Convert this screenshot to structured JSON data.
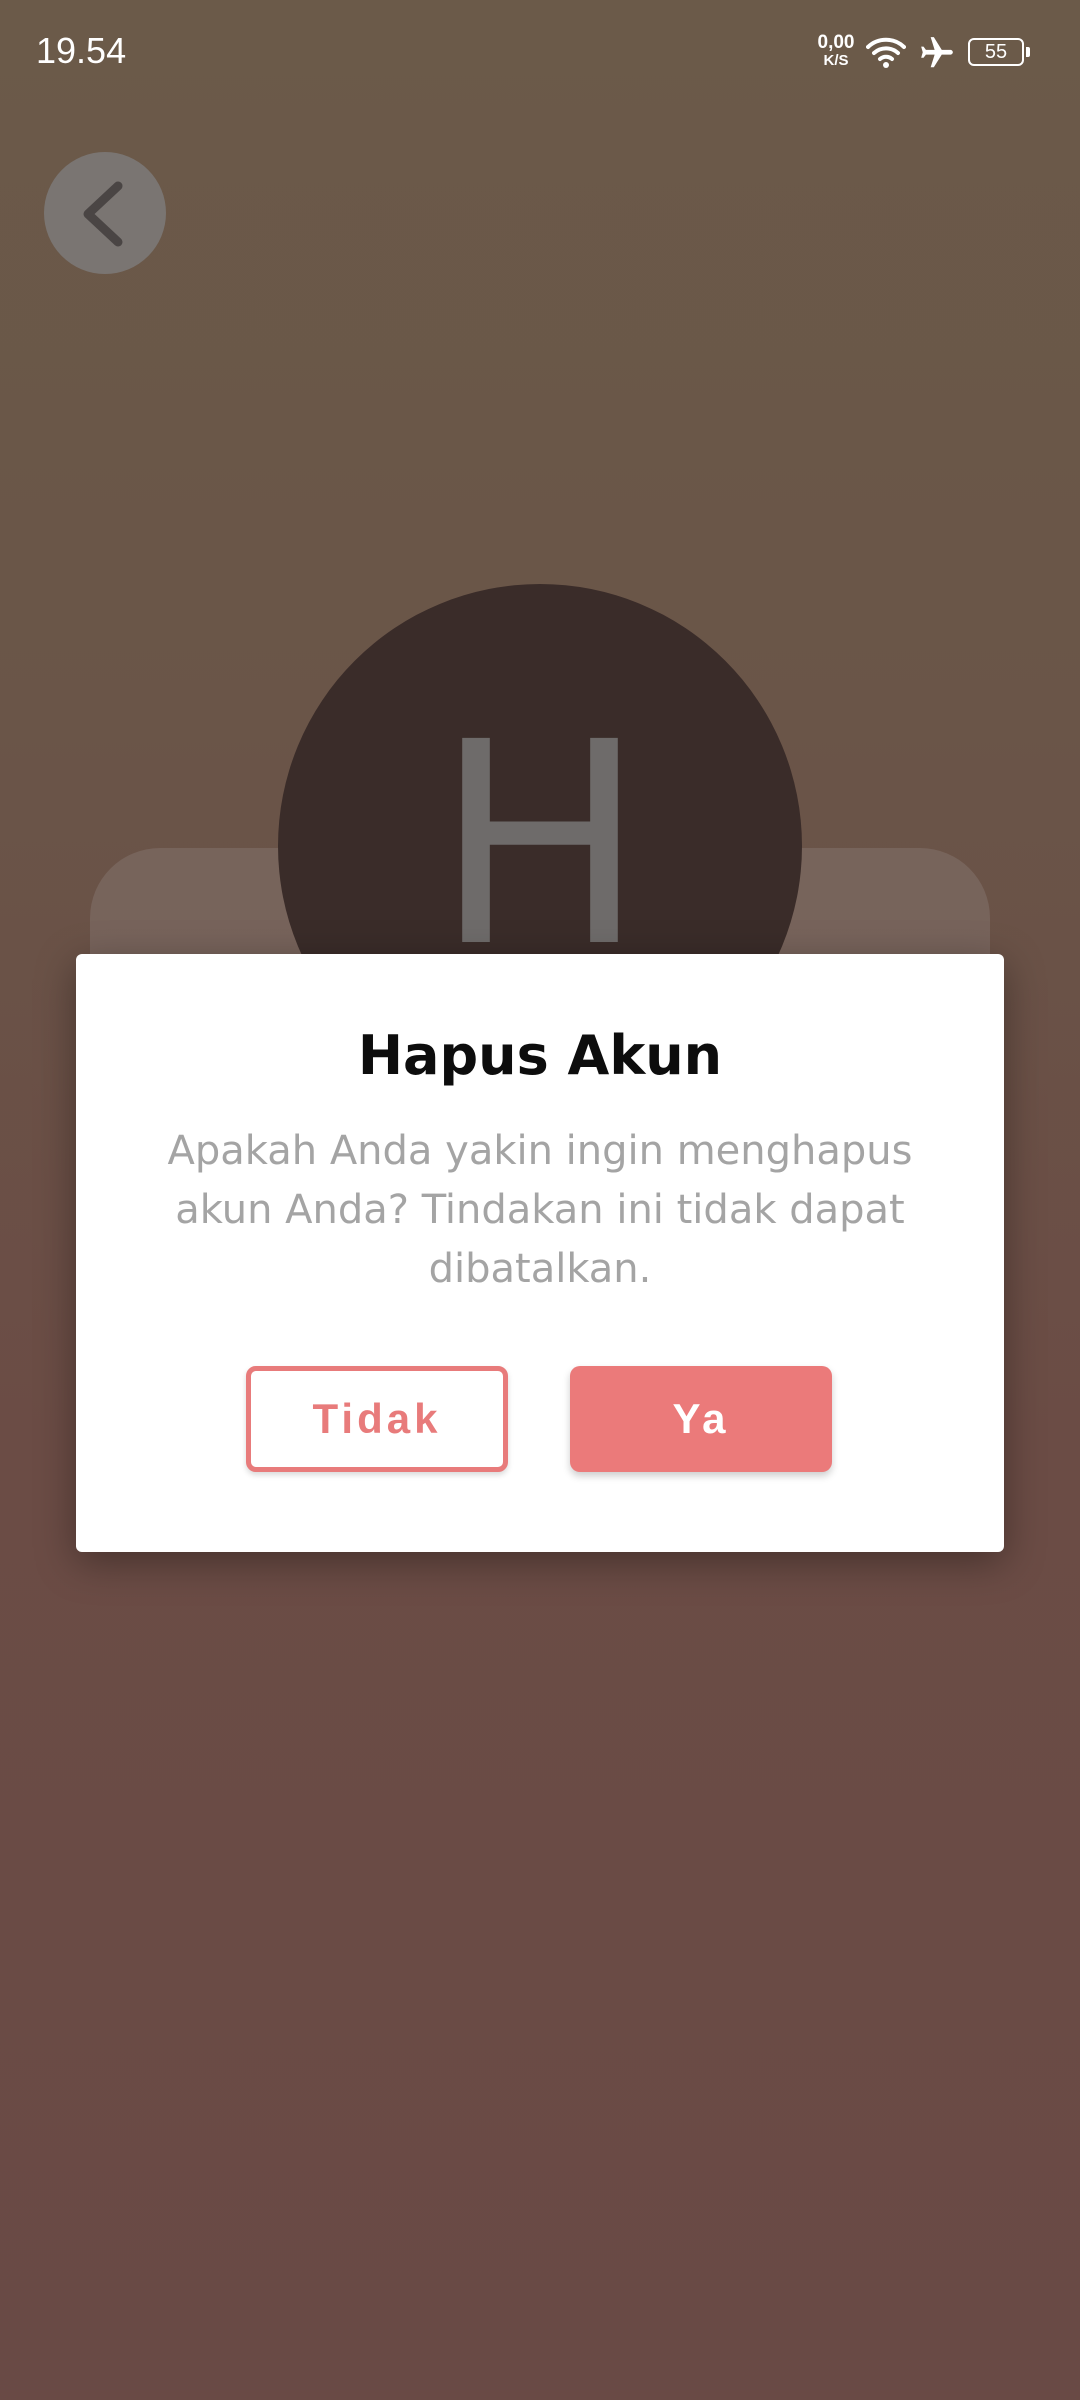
{
  "status_bar": {
    "time": "19.54",
    "net_speed_value": "0,00",
    "net_speed_unit": "K/S",
    "battery_level": "55",
    "icons": [
      "wifi-icon",
      "airplane-mode-icon",
      "battery-icon"
    ]
  },
  "header": {
    "back_icon": "chevron-left-icon"
  },
  "profile": {
    "avatar_initial": "H"
  },
  "dialog": {
    "title": "Hapus Akun",
    "message": "Apakah Anda yakin ingin menghapus akun Anda? Tindakan ini tidak dapat dibatalkan.",
    "cancel_label": "Tidak",
    "confirm_label": "Ya"
  },
  "colors": {
    "accent": "#eb7a7a",
    "overlay_top": "#6b5a49",
    "overlay_bottom": "#694a45"
  }
}
